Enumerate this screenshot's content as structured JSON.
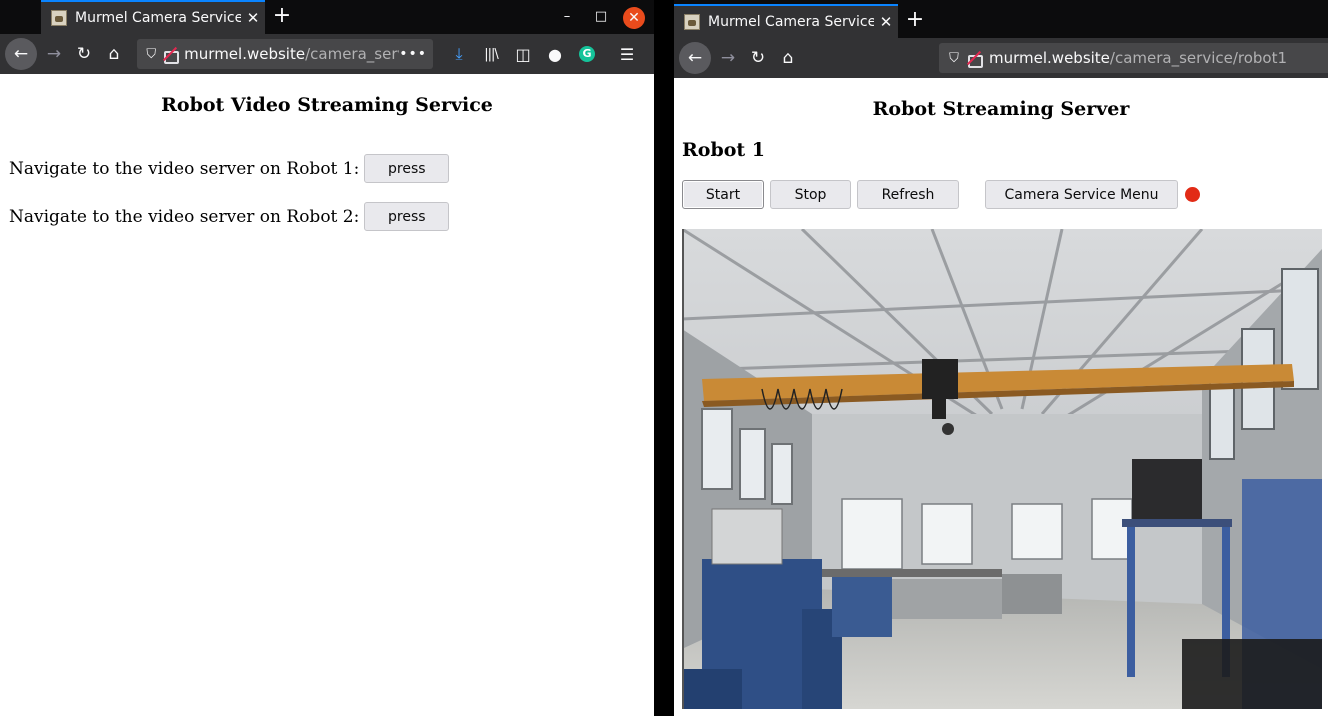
{
  "windows": [
    {
      "tab": {
        "title": "Murmel Camera Service",
        "close": "✕"
      },
      "newtab": "+",
      "url": {
        "host": "murmel.website",
        "path": "/camera_serv",
        "more": "•••"
      },
      "page": {
        "title": "Robot Video Streaming Service",
        "links": [
          {
            "label": "Navigate to the video server on Robot 1:",
            "button": "press"
          },
          {
            "label": "Navigate to the video server on Robot 2:",
            "button": "press"
          }
        ]
      }
    },
    {
      "tab": {
        "title": "Murmel Camera Service",
        "close": "✕"
      },
      "newtab": "+",
      "url": {
        "host": "murmel.website",
        "path": "/camera_service/robot1"
      },
      "page": {
        "title": "Robot Streaming Server",
        "robot": "Robot 1",
        "buttons": {
          "start": "Start",
          "stop": "Stop",
          "refresh": "Refresh",
          "menu": "Camera Service Menu"
        },
        "recording_color": "#e22b16"
      }
    }
  ],
  "icons": {
    "back": "←",
    "forward": "→",
    "reload": "↻",
    "home": "⌂",
    "shield": "⛉",
    "download": "⤓",
    "library": "|||\\",
    "sidebar": "◫",
    "account": "●",
    "grammarly": "G",
    "menu": "☰",
    "minimize": "–",
    "maximize": "□",
    "close": "✕"
  }
}
